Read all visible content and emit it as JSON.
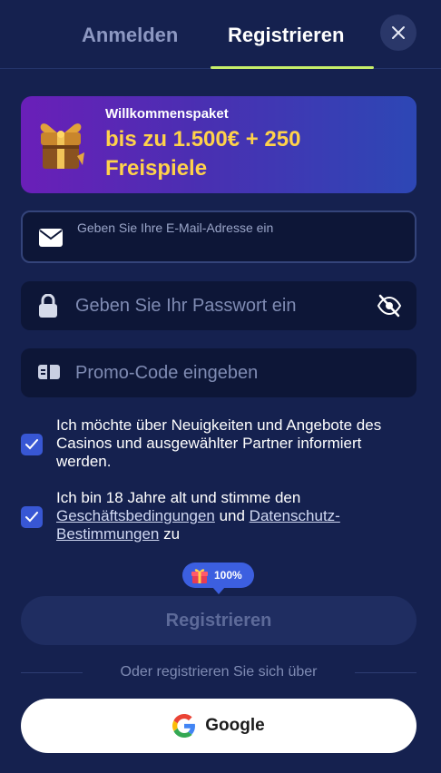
{
  "header": {
    "tabs": [
      {
        "label": "Anmelden",
        "active": false
      },
      {
        "label": "Registrieren",
        "active": true
      }
    ],
    "close_icon": "close-icon"
  },
  "banner": {
    "icon": "gift-chest-icon",
    "subtitle": "Willkommenspaket",
    "headline": "bis zu 1.500€ + 250 Freispiele"
  },
  "form": {
    "email": {
      "icon": "envelope-icon",
      "placeholder": "Geben Sie Ihre E-Mail-Adresse ein",
      "value": ""
    },
    "password": {
      "icon": "lock-icon",
      "placeholder": "Geben Sie Ihr Passwort ein",
      "value": "",
      "toggle_icon": "eye-off-icon"
    },
    "promo": {
      "icon": "ticket-icon",
      "placeholder": "Promo-Code eingeben",
      "value": ""
    }
  },
  "consents": {
    "newsletter": {
      "checked": true,
      "text": "Ich möchte über Neuigkeiten und Angebote des Casinos und ausgewählter Partner informiert werden."
    },
    "terms": {
      "checked": true,
      "text_before": "Ich bin 18 Jahre alt und stimme den ",
      "link_terms": "Geschäftsbedingungen",
      "text_middle": " und ",
      "link_privacy": "Datenschutz-Bestimmungen",
      "text_after": " zu"
    }
  },
  "bonus_badge": {
    "icon": "gift-icon",
    "label": "100%"
  },
  "submit": {
    "label": "Registrieren",
    "disabled": true
  },
  "divider": {
    "label": "Oder registrieren Sie sich über"
  },
  "social": {
    "google": {
      "icon": "google-icon",
      "label": "Google"
    }
  },
  "colors": {
    "background": "#15214f",
    "accent_tab": "#c7ef6a",
    "banner_headline": "#ffd24a",
    "checkbox": "#3857d4",
    "input_bg": "#0d1637"
  }
}
